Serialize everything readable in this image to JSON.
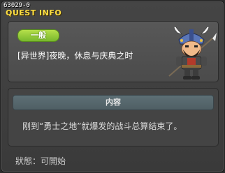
{
  "quest_id": "63029-0",
  "window_title": "QUEST INFO",
  "quest": {
    "category": "一般",
    "name": "[异世界]夜晚，休息与庆典之时"
  },
  "content": {
    "header": "内容",
    "description": "刚到“勇士之地”就爆发的战斗总算结束了。"
  },
  "status": {
    "text": "狀態：可開始"
  },
  "colors": {
    "title": "#ffe043",
    "badge": "#8cc63f",
    "panel": "#4b4b4b"
  }
}
